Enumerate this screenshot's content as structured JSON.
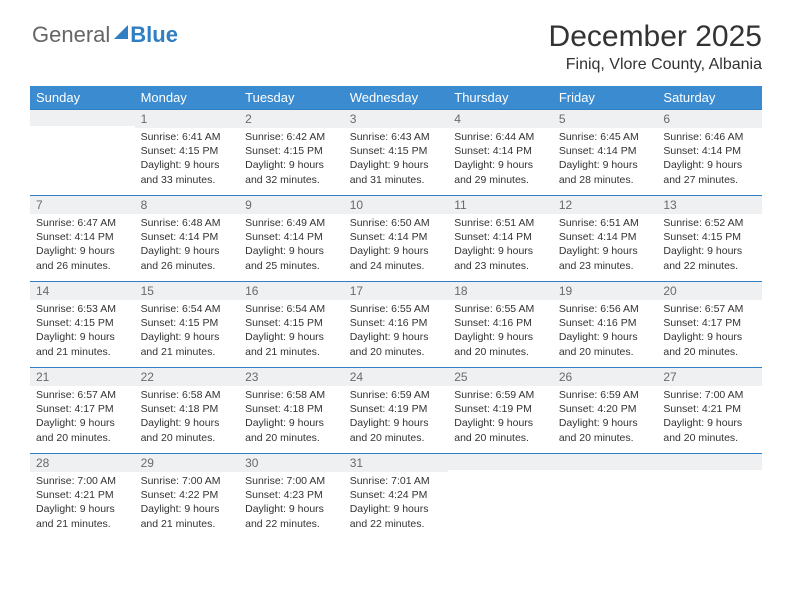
{
  "brand": {
    "part1": "General",
    "part2": "Blue"
  },
  "title": "December 2025",
  "location": "Finiq, Vlore County, Albania",
  "weekdays": [
    "Sunday",
    "Monday",
    "Tuesday",
    "Wednesday",
    "Thursday",
    "Friday",
    "Saturday"
  ],
  "weeks": [
    [
      {
        "n": "",
        "sr": "",
        "ss": "",
        "dl": ""
      },
      {
        "n": "1",
        "sr": "Sunrise: 6:41 AM",
        "ss": "Sunset: 4:15 PM",
        "dl": "Daylight: 9 hours and 33 minutes."
      },
      {
        "n": "2",
        "sr": "Sunrise: 6:42 AM",
        "ss": "Sunset: 4:15 PM",
        "dl": "Daylight: 9 hours and 32 minutes."
      },
      {
        "n": "3",
        "sr": "Sunrise: 6:43 AM",
        "ss": "Sunset: 4:15 PM",
        "dl": "Daylight: 9 hours and 31 minutes."
      },
      {
        "n": "4",
        "sr": "Sunrise: 6:44 AM",
        "ss": "Sunset: 4:14 PM",
        "dl": "Daylight: 9 hours and 29 minutes."
      },
      {
        "n": "5",
        "sr": "Sunrise: 6:45 AM",
        "ss": "Sunset: 4:14 PM",
        "dl": "Daylight: 9 hours and 28 minutes."
      },
      {
        "n": "6",
        "sr": "Sunrise: 6:46 AM",
        "ss": "Sunset: 4:14 PM",
        "dl": "Daylight: 9 hours and 27 minutes."
      }
    ],
    [
      {
        "n": "7",
        "sr": "Sunrise: 6:47 AM",
        "ss": "Sunset: 4:14 PM",
        "dl": "Daylight: 9 hours and 26 minutes."
      },
      {
        "n": "8",
        "sr": "Sunrise: 6:48 AM",
        "ss": "Sunset: 4:14 PM",
        "dl": "Daylight: 9 hours and 26 minutes."
      },
      {
        "n": "9",
        "sr": "Sunrise: 6:49 AM",
        "ss": "Sunset: 4:14 PM",
        "dl": "Daylight: 9 hours and 25 minutes."
      },
      {
        "n": "10",
        "sr": "Sunrise: 6:50 AM",
        "ss": "Sunset: 4:14 PM",
        "dl": "Daylight: 9 hours and 24 minutes."
      },
      {
        "n": "11",
        "sr": "Sunrise: 6:51 AM",
        "ss": "Sunset: 4:14 PM",
        "dl": "Daylight: 9 hours and 23 minutes."
      },
      {
        "n": "12",
        "sr": "Sunrise: 6:51 AM",
        "ss": "Sunset: 4:14 PM",
        "dl": "Daylight: 9 hours and 23 minutes."
      },
      {
        "n": "13",
        "sr": "Sunrise: 6:52 AM",
        "ss": "Sunset: 4:15 PM",
        "dl": "Daylight: 9 hours and 22 minutes."
      }
    ],
    [
      {
        "n": "14",
        "sr": "Sunrise: 6:53 AM",
        "ss": "Sunset: 4:15 PM",
        "dl": "Daylight: 9 hours and 21 minutes."
      },
      {
        "n": "15",
        "sr": "Sunrise: 6:54 AM",
        "ss": "Sunset: 4:15 PM",
        "dl": "Daylight: 9 hours and 21 minutes."
      },
      {
        "n": "16",
        "sr": "Sunrise: 6:54 AM",
        "ss": "Sunset: 4:15 PM",
        "dl": "Daylight: 9 hours and 21 minutes."
      },
      {
        "n": "17",
        "sr": "Sunrise: 6:55 AM",
        "ss": "Sunset: 4:16 PM",
        "dl": "Daylight: 9 hours and 20 minutes."
      },
      {
        "n": "18",
        "sr": "Sunrise: 6:55 AM",
        "ss": "Sunset: 4:16 PM",
        "dl": "Daylight: 9 hours and 20 minutes."
      },
      {
        "n": "19",
        "sr": "Sunrise: 6:56 AM",
        "ss": "Sunset: 4:16 PM",
        "dl": "Daylight: 9 hours and 20 minutes."
      },
      {
        "n": "20",
        "sr": "Sunrise: 6:57 AM",
        "ss": "Sunset: 4:17 PM",
        "dl": "Daylight: 9 hours and 20 minutes."
      }
    ],
    [
      {
        "n": "21",
        "sr": "Sunrise: 6:57 AM",
        "ss": "Sunset: 4:17 PM",
        "dl": "Daylight: 9 hours and 20 minutes."
      },
      {
        "n": "22",
        "sr": "Sunrise: 6:58 AM",
        "ss": "Sunset: 4:18 PM",
        "dl": "Daylight: 9 hours and 20 minutes."
      },
      {
        "n": "23",
        "sr": "Sunrise: 6:58 AM",
        "ss": "Sunset: 4:18 PM",
        "dl": "Daylight: 9 hours and 20 minutes."
      },
      {
        "n": "24",
        "sr": "Sunrise: 6:59 AM",
        "ss": "Sunset: 4:19 PM",
        "dl": "Daylight: 9 hours and 20 minutes."
      },
      {
        "n": "25",
        "sr": "Sunrise: 6:59 AM",
        "ss": "Sunset: 4:19 PM",
        "dl": "Daylight: 9 hours and 20 minutes."
      },
      {
        "n": "26",
        "sr": "Sunrise: 6:59 AM",
        "ss": "Sunset: 4:20 PM",
        "dl": "Daylight: 9 hours and 20 minutes."
      },
      {
        "n": "27",
        "sr": "Sunrise: 7:00 AM",
        "ss": "Sunset: 4:21 PM",
        "dl": "Daylight: 9 hours and 20 minutes."
      }
    ],
    [
      {
        "n": "28",
        "sr": "Sunrise: 7:00 AM",
        "ss": "Sunset: 4:21 PM",
        "dl": "Daylight: 9 hours and 21 minutes."
      },
      {
        "n": "29",
        "sr": "Sunrise: 7:00 AM",
        "ss": "Sunset: 4:22 PM",
        "dl": "Daylight: 9 hours and 21 minutes."
      },
      {
        "n": "30",
        "sr": "Sunrise: 7:00 AM",
        "ss": "Sunset: 4:23 PM",
        "dl": "Daylight: 9 hours and 22 minutes."
      },
      {
        "n": "31",
        "sr": "Sunrise: 7:01 AM",
        "ss": "Sunset: 4:24 PM",
        "dl": "Daylight: 9 hours and 22 minutes."
      },
      {
        "n": "",
        "sr": "",
        "ss": "",
        "dl": ""
      },
      {
        "n": "",
        "sr": "",
        "ss": "",
        "dl": ""
      },
      {
        "n": "",
        "sr": "",
        "ss": "",
        "dl": ""
      }
    ]
  ]
}
